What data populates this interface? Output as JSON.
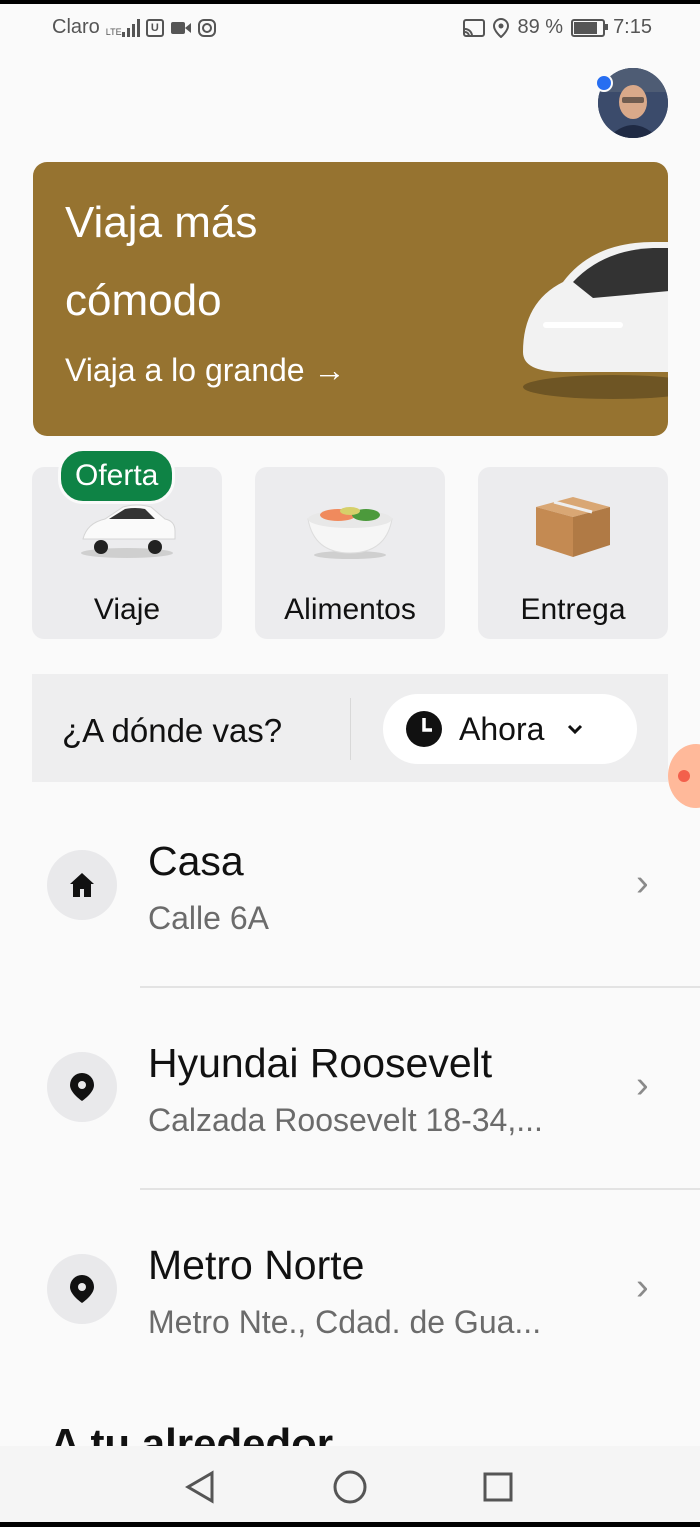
{
  "status_bar": {
    "carrier": "Claro",
    "network": "LTE",
    "battery": "89 %",
    "battery_level": 0.89,
    "time": "7:15"
  },
  "promo": {
    "title": "Viaja más cómodo",
    "link": "Viaja a lo grande →",
    "bg_color": "#967330"
  },
  "services": [
    {
      "label": "Viaje",
      "badge": "Oferta",
      "icon": "car-icon"
    },
    {
      "label": "Alimentos",
      "icon": "food-bowl-icon"
    },
    {
      "label": "Entrega",
      "icon": "package-icon"
    }
  ],
  "search": {
    "placeholder": "¿A dónde vas?",
    "time_option": "Ahora"
  },
  "places": [
    {
      "name": "Casa",
      "address": "Calle 6A",
      "icon": "home-icon"
    },
    {
      "name": "Hyundai Roosevelt",
      "address": "Calzada Roosevelt 18-34,...",
      "icon": "location-pin-icon"
    },
    {
      "name": "Metro Norte",
      "address": "Metro Nte., Cdad. de Gua...",
      "icon": "location-pin-icon"
    }
  ],
  "section_title": "A tu alrededor",
  "colors": {
    "promo": "#967330",
    "badge": "#0e8345",
    "accent": "#276ef1"
  }
}
